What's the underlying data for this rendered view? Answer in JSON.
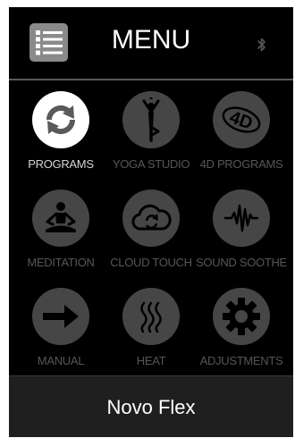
{
  "header": {
    "title": "MENU",
    "menu_icon": "list-icon",
    "status_icon": "bluetooth-icon"
  },
  "menu_items": [
    {
      "label": "PROGRAMS",
      "icon": "sync-icon",
      "active": true
    },
    {
      "label": "YOGA STUDIO",
      "icon": "yoga-pose-icon",
      "active": false
    },
    {
      "label": "4D PROGRAMS",
      "icon": "4d-icon",
      "active": false
    },
    {
      "label": "MEDITATION",
      "icon": "meditation-icon",
      "active": false
    },
    {
      "label": "CLOUD TOUCH",
      "icon": "cloud-icon",
      "active": false
    },
    {
      "label": "SOUND SOOTHE",
      "icon": "sound-wave-icon",
      "active": false
    },
    {
      "label": "MANUAL",
      "icon": "arrow-right-icon",
      "active": false
    },
    {
      "label": "HEAT",
      "icon": "heat-icon",
      "active": false
    },
    {
      "label": "ADJUSTMENTS",
      "icon": "gear-icon",
      "active": false
    }
  ],
  "footer": {
    "device_name": "Novo Flex"
  },
  "colors": {
    "background": "#000000",
    "icon_inactive": "#464646",
    "icon_active": "#ffffff",
    "label_inactive": "#565656",
    "label_active": "#d4d4d4",
    "footer": "#1f1f1f"
  }
}
